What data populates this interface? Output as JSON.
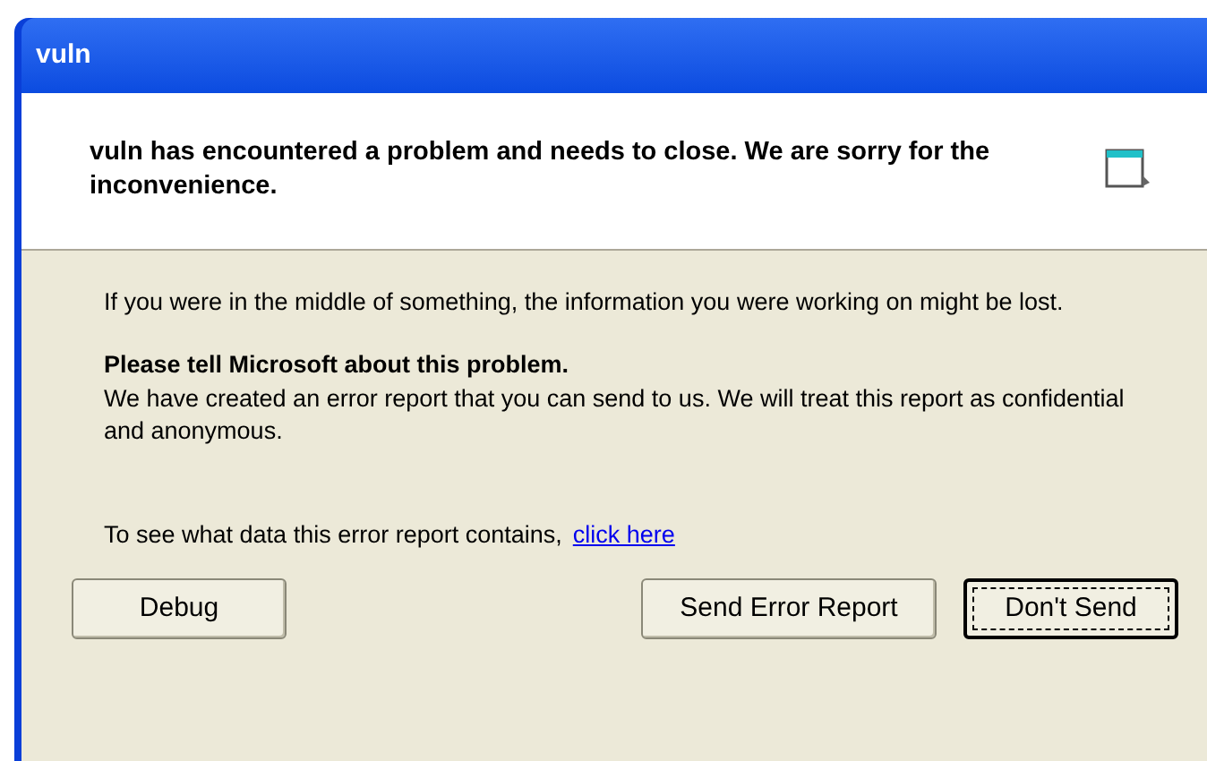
{
  "window": {
    "title": "vuln"
  },
  "header": {
    "message": "vuln has encountered a problem and needs to close.  We are sorry for the inconvenience."
  },
  "body": {
    "info": "If you were in the middle of something, the information you were working on might be lost.",
    "heading": "Please tell Microsoft about this problem.",
    "report_text": "We have created an error report that you can send to us.  We will treat this report as confidential and anonymous.",
    "details_prompt": "To see what data this error report contains,",
    "details_link": "click here"
  },
  "buttons": [
    {
      "label": "Debug",
      "default": false
    },
    {
      "label": "Send Error Report",
      "default": false
    },
    {
      "label": "Don't Send",
      "default": true
    }
  ]
}
